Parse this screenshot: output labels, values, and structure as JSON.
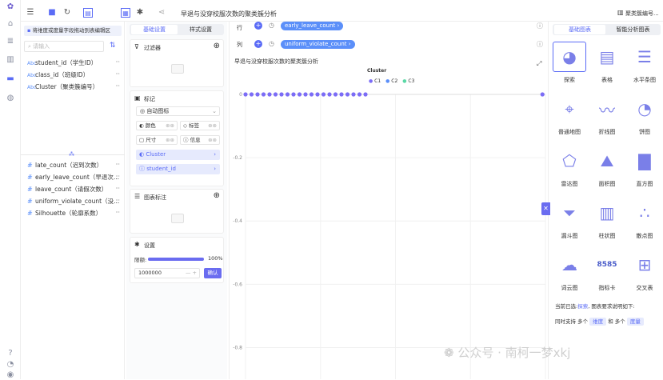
{
  "topbar": {
    "title": "早退与没穿校服次数的聚类簇分析",
    "right_label": "聚类簇编号..."
  },
  "field_panel": {
    "hint": "将维度或度量字段拖动到表编辑区",
    "search_placeholder": "请输入",
    "dimensions": [
      {
        "tag": "Abc",
        "label": "student_id（学生ID）"
      },
      {
        "tag": "Abc",
        "label": "class_id（班级ID）"
      },
      {
        "tag": "Abc",
        "label": "Cluster（聚类簇编号）"
      }
    ],
    "measures": [
      {
        "tag": "#",
        "label": "late_count（迟到次数）"
      },
      {
        "tag": "#",
        "label": "early_leave_count（早退次..."
      },
      {
        "tag": "#",
        "label": "leave_count（请假次数）"
      },
      {
        "tag": "#",
        "label": "uniform_violate_count（没..."
      },
      {
        "tag": "#",
        "label": "Silhouette（轮廓系数）"
      }
    ]
  },
  "config_panel": {
    "tab_basic": "基础设置",
    "tab_style": "样式设置",
    "filter_title": "过滤器",
    "mark_title": "标记",
    "mark_type": "自动图标",
    "enc_color": "颜色",
    "enc_label": "标签",
    "enc_size": "尺寸",
    "enc_info": "信息",
    "enc_cluster": "Cluster",
    "enc_student": "student_id",
    "annot_title": "图表标注",
    "settings_title": "设置",
    "limit_label": "限额:",
    "limit_percent": "100%",
    "limit_fraction": 1.0,
    "limit_value": "1000000",
    "confirm_label": "确认"
  },
  "canvas": {
    "row_label": "行",
    "col_label": "列",
    "row_field": "early_leave_count",
    "col_field": "uniform_violate_count",
    "chart_title": "早退与没穿校服次数的聚类簇分析"
  },
  "chart_data": {
    "type": "scatter",
    "title": "早退与没穿校服次数的聚类簇分析",
    "legend_title": "Cluster",
    "legend_position": "top",
    "legend": [
      "C1",
      "C2",
      "C3"
    ],
    "colors": [
      "#7b6cf6",
      "#5b8ff9",
      "#5ad8a6"
    ],
    "yticks": [
      "0",
      "-0.2",
      "-0.4",
      "-0.6",
      "-0.8"
    ],
    "ylim": [
      -0.9,
      0
    ],
    "xlim": [
      0,
      1
    ],
    "grid": true,
    "series": [
      {
        "name": "C1",
        "points": [
          [
            0.0,
            0
          ],
          [
            0.02,
            0
          ],
          [
            0.04,
            0
          ],
          [
            0.06,
            0
          ],
          [
            0.08,
            0
          ],
          [
            0.1,
            0
          ],
          [
            0.12,
            0
          ],
          [
            0.14,
            0
          ],
          [
            0.16,
            0
          ],
          [
            0.18,
            0
          ],
          [
            0.2,
            0
          ],
          [
            0.22,
            0
          ],
          [
            0.24,
            0
          ],
          [
            0.26,
            0
          ],
          [
            0.28,
            0
          ],
          [
            0.3,
            0
          ],
          [
            0.32,
            0
          ],
          [
            0.34,
            0
          ],
          [
            0.36,
            0
          ],
          [
            0.38,
            0
          ],
          [
            0.4,
            0
          ],
          [
            0.99,
            0
          ]
        ]
      }
    ]
  },
  "chart_panel": {
    "tab_basic": "基础图表",
    "tab_smart": "智能分析图表",
    "types": [
      "探索",
      "表格",
      "水平条图",
      "普通地图",
      "折线图",
      "饼图",
      "雷达图",
      "面积图",
      "直方图",
      "漏斗图",
      "柱状图",
      "散点图",
      "词云图",
      "指标卡",
      "交叉表"
    ],
    "metric_sample": "8585",
    "selected_prefix": "当前已选:",
    "selected_type": "探索",
    "selected_suffix": ", 图表要求说明如下:",
    "support_text1": "同时支持 多个",
    "support_dim": "维度",
    "support_text2": "和 多个",
    "support_measure": "度量"
  },
  "watermark": "公众号 · 南柯一梦xkj"
}
